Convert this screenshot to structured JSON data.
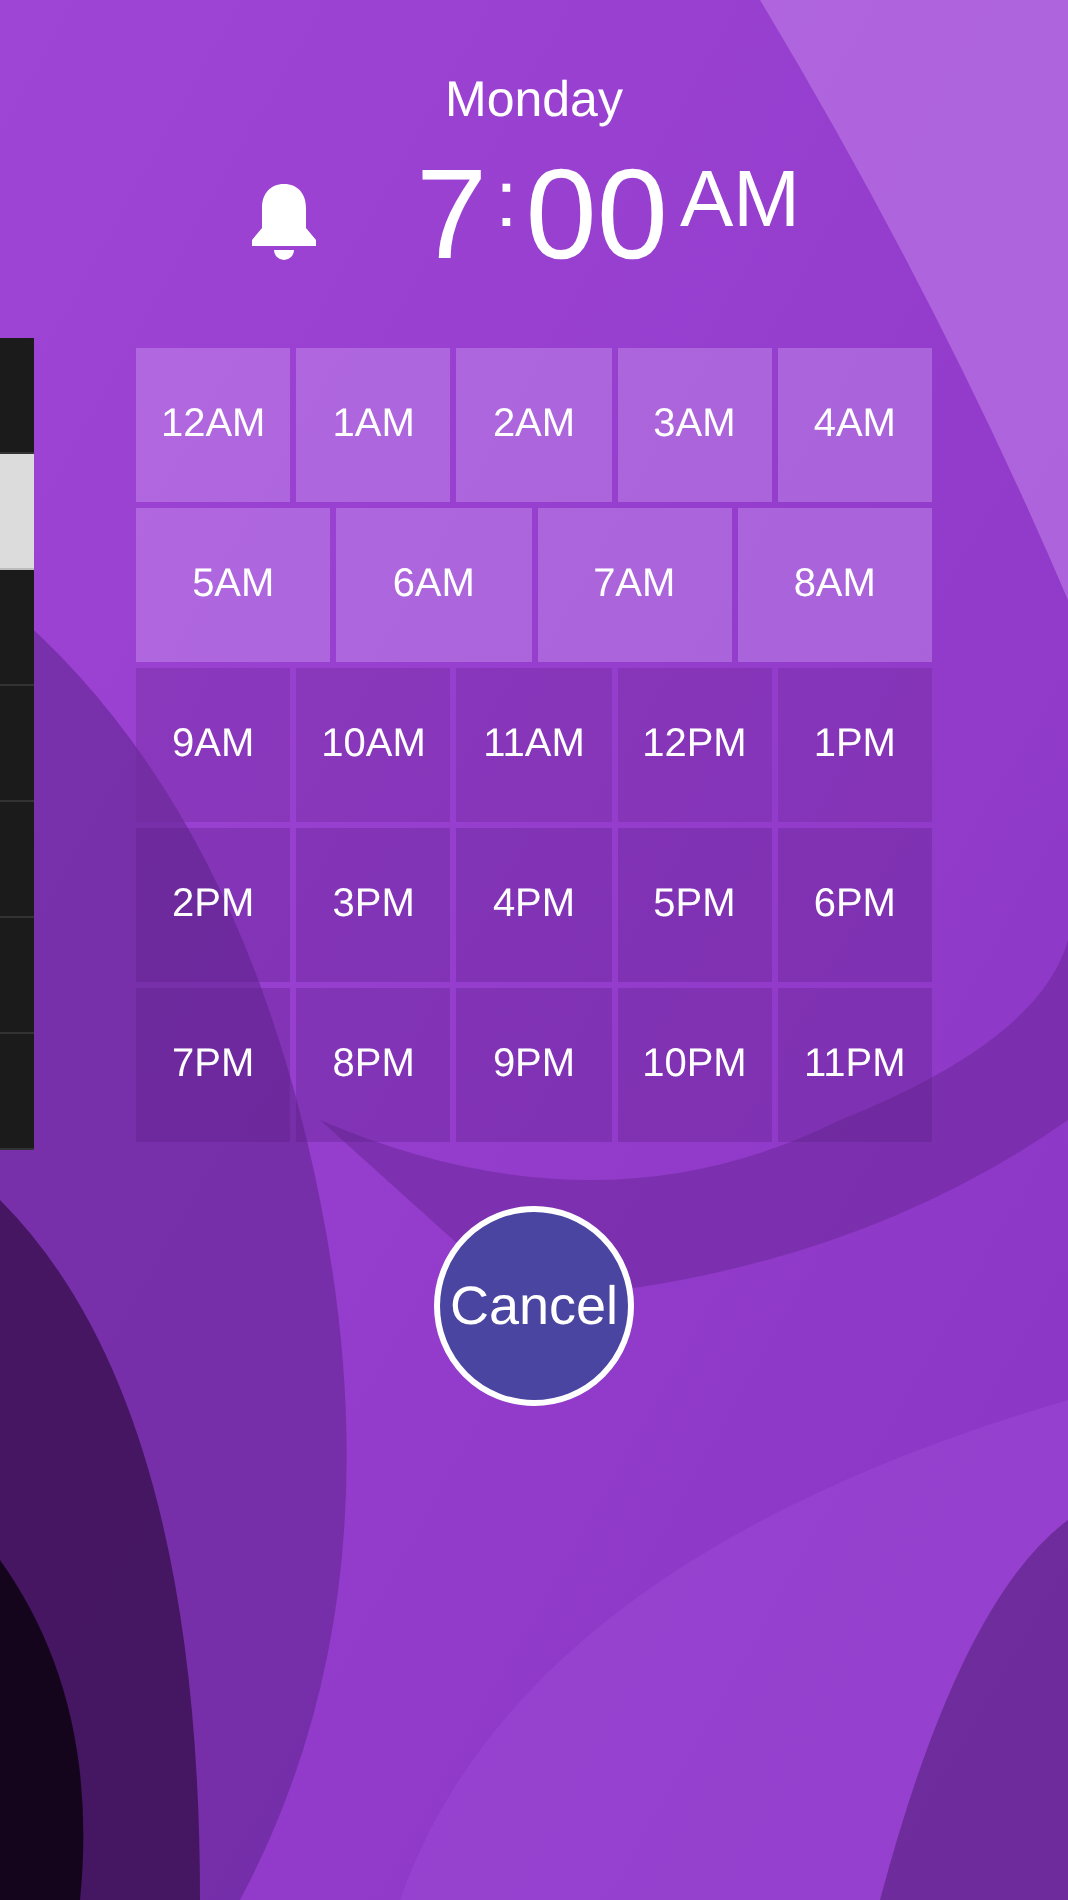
{
  "day": "Monday",
  "time": {
    "hour": "7",
    "separator": ":",
    "minutes": "00",
    "period": "AM"
  },
  "side_tabs": [
    {
      "selected": false
    },
    {
      "selected": true
    },
    {
      "selected": false
    },
    {
      "selected": false
    },
    {
      "selected": false
    },
    {
      "selected": false
    },
    {
      "selected": false
    }
  ],
  "hour_rows": [
    {
      "hours": [
        "12AM",
        "1AM",
        "2AM",
        "3AM",
        "4AM"
      ]
    },
    {
      "hours": [
        "5AM",
        "6AM",
        "7AM",
        "8AM"
      ]
    },
    {
      "hours": [
        "9AM",
        "10AM",
        "11AM",
        "12PM",
        "1PM"
      ]
    },
    {
      "hours": [
        "2PM",
        "3PM",
        "4PM",
        "5PM",
        "6PM"
      ]
    },
    {
      "hours": [
        "7PM",
        "8PM",
        "9PM",
        "10PM",
        "11PM"
      ]
    }
  ],
  "cancel_button": "Cancel"
}
